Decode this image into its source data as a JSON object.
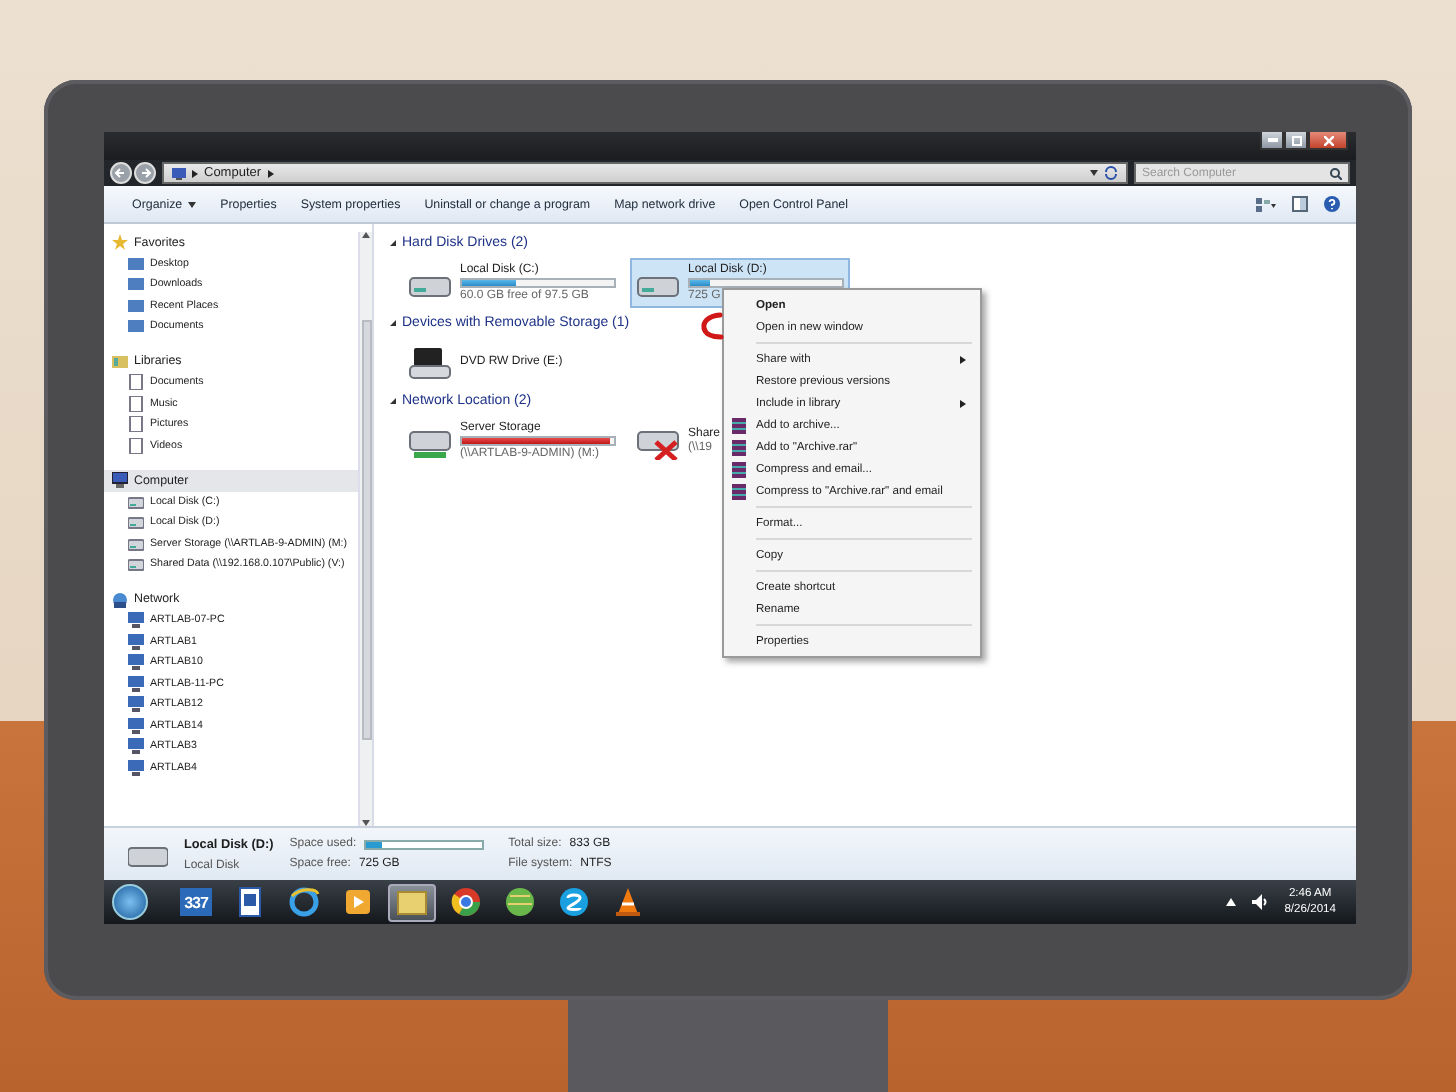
{
  "address_bar": {
    "path": [
      "Computer"
    ],
    "search": {
      "placeholder": "Search Computer"
    }
  },
  "toolbar": {
    "buttons": [
      {
        "label": "Organize",
        "dropdown": true
      },
      {
        "label": "Properties",
        "dropdown": false
      },
      {
        "label": "System properties",
        "dropdown": false
      },
      {
        "label": "Uninstall or change a program",
        "dropdown": false
      },
      {
        "label": "Map network drive",
        "dropdown": false
      },
      {
        "label": "Open Control Panel",
        "dropdown": false
      }
    ]
  },
  "sidebar": {
    "groups": [
      {
        "kind": "favorites",
        "label": "Favorites",
        "selected": false,
        "children": [
          {
            "label": "Desktop",
            "selected": false
          },
          {
            "label": "Downloads",
            "selected": false
          },
          {
            "label": "Recent Places",
            "selected": false
          },
          {
            "label": "Documents",
            "selected": false
          }
        ]
      },
      {
        "kind": "libraries",
        "label": "Libraries",
        "selected": false,
        "children": [
          {
            "label": "Documents",
            "selected": false
          },
          {
            "label": "Music",
            "selected": false
          },
          {
            "label": "Pictures",
            "selected": false
          },
          {
            "label": "Videos",
            "selected": false
          }
        ]
      },
      {
        "kind": "computer",
        "label": "Computer",
        "selected": true,
        "children": [
          {
            "label": "Local Disk (C:)",
            "selected": false
          },
          {
            "label": "Local Disk (D:)",
            "selected": false
          },
          {
            "label": "Server Storage (\\\\ARTLAB-9-ADMIN) (M:)",
            "selected": false
          },
          {
            "label": "Shared Data (\\\\192.168.0.107\\Public) (V:)",
            "selected": false
          }
        ]
      },
      {
        "kind": "network",
        "label": "Network",
        "selected": false,
        "children": [
          {
            "label": "ARTLAB-07-PC",
            "selected": false
          },
          {
            "label": "ARTLAB1",
            "selected": false
          },
          {
            "label": "ARTLAB10",
            "selected": false
          },
          {
            "label": "ARTLAB-11-PC",
            "selected": false
          },
          {
            "label": "ARTLAB12",
            "selected": false
          },
          {
            "label": "ARTLAB14",
            "selected": false
          },
          {
            "label": "ARTLAB3",
            "selected": false
          },
          {
            "label": "ARTLAB4",
            "selected": false
          }
        ]
      }
    ]
  },
  "content": {
    "groups": [
      {
        "label": "Hard Disk Drives (2)",
        "items": [
          {
            "kind": "hdd",
            "name": "Local Disk (C:)",
            "level": 0.36,
            "detail": "60.0 GB free of 97.5 GB",
            "selected": false
          },
          {
            "kind": "hdd",
            "name": "Local Disk (D:)",
            "level": 0.13,
            "detail": "725 G",
            "selected": true
          }
        ]
      },
      {
        "label": "Devices with Removable Storage (1)",
        "items": [
          {
            "kind": "dvd",
            "name": "DVD RW Drive (E:)",
            "selected": false
          }
        ]
      },
      {
        "label": "Network Location (2)",
        "items": [
          {
            "kind": "network",
            "name": "Server Storage",
            "detail": "(\\\\ARTLAB-9-ADMIN) (M:)",
            "level": 0.98,
            "selected": false
          },
          {
            "kind": "network_disconnected",
            "name": "Share",
            "detail": "(\\\\19",
            "selected": false
          }
        ]
      }
    ]
  },
  "context_menu": {
    "items": [
      {
        "kind": "command",
        "label": "Open",
        "default": true,
        "submenu": false
      },
      {
        "kind": "command",
        "label": "Open in new window",
        "default": false,
        "submenu": false
      },
      {
        "kind": "separator"
      },
      {
        "kind": "command",
        "label": "Share with",
        "default": false,
        "submenu": true
      },
      {
        "kind": "command",
        "label": "Restore previous versions",
        "default": false,
        "submenu": false
      },
      {
        "kind": "command",
        "label": "Include in library",
        "default": false,
        "submenu": true
      },
      {
        "kind": "archive",
        "label": "Add to archive...",
        "default": false,
        "submenu": false
      },
      {
        "kind": "archive",
        "label": "Add to \"Archive.rar\"",
        "default": false,
        "submenu": false
      },
      {
        "kind": "archive",
        "label": "Compress and email...",
        "default": false,
        "submenu": false
      },
      {
        "kind": "archive",
        "label": "Compress to \"Archive.rar\" and email",
        "default": false,
        "submenu": false
      },
      {
        "kind": "separator"
      },
      {
        "kind": "command",
        "label": "Format...",
        "default": false,
        "submenu": false
      },
      {
        "kind": "separator"
      },
      {
        "kind": "command",
        "label": "Copy",
        "default": false,
        "submenu": false
      },
      {
        "kind": "separator"
      },
      {
        "kind": "command",
        "label": "Create shortcut",
        "default": false,
        "submenu": false
      },
      {
        "kind": "command",
        "label": "Rename",
        "default": false,
        "submenu": false
      },
      {
        "kind": "separator"
      },
      {
        "kind": "command",
        "label": "Properties",
        "default": false,
        "submenu": false
      }
    ]
  },
  "details": {
    "name": "Local Disk (D:)",
    "type": "Local Disk",
    "space_used_label": "Space used:",
    "level": 0.13,
    "space_free_label": "Space free:",
    "space_free": "725 GB",
    "total_size_label": "Total size:",
    "total_size": "833 GB",
    "file_system_label": "File system:",
    "file_system": "NTFS"
  },
  "taskbar": {
    "apps": [
      {
        "kind": "calendar",
        "label": "337",
        "selected": false
      },
      {
        "kind": "document",
        "selected": false
      },
      {
        "kind": "browser_e",
        "selected": false
      },
      {
        "kind": "media",
        "selected": false
      },
      {
        "kind": "folder",
        "selected": true
      },
      {
        "kind": "browser_circle",
        "selected": false
      },
      {
        "kind": "globe",
        "selected": false
      },
      {
        "kind": "chat",
        "selected": false
      },
      {
        "kind": "cone",
        "selected": false
      }
    ],
    "time": "2:46 AM",
    "date": "8/26/2014"
  }
}
